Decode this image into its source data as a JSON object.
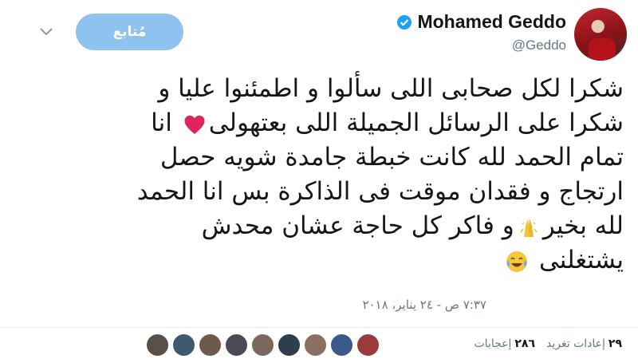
{
  "header": {
    "display_name": "Mohamed Geddo",
    "handle": "@Geddo",
    "follow_label": "مُتابع",
    "verified": true
  },
  "tweet": {
    "lines": [
      "شكرا لكل صحابى اللى سألوا و اطمئنوا عليا و",
      "شكرا على الرسائل الجميلة اللى بعتهولى",
      "انا",
      "تمام الحمد لله كانت خبطة جامدة شويه حصل",
      "ارتجاج و فقدان موقت فى الذاكرة بس انا الحمد",
      "لله بخير",
      "و فاكر كل حاجة عشان محدش",
      "يشتغلنى"
    ],
    "timestamp": "٧:٣٧ ص - ٢٤ يناير، ٢٠١٨"
  },
  "emojis": {
    "heart": "heart-icon",
    "pray": "folded-hands-icon",
    "laugh": "tears-of-joy-icon"
  },
  "stats": {
    "retweets_count": "٢٩",
    "retweets_label": "إعادات تغريد",
    "likes_count": "٢٨٦",
    "likes_label": "إعجابات"
  },
  "colors": {
    "follow_button": "#8fc3ef",
    "verified_badge": "#1da1f2",
    "heart": "#e0245e",
    "muted_text": "#657786"
  }
}
